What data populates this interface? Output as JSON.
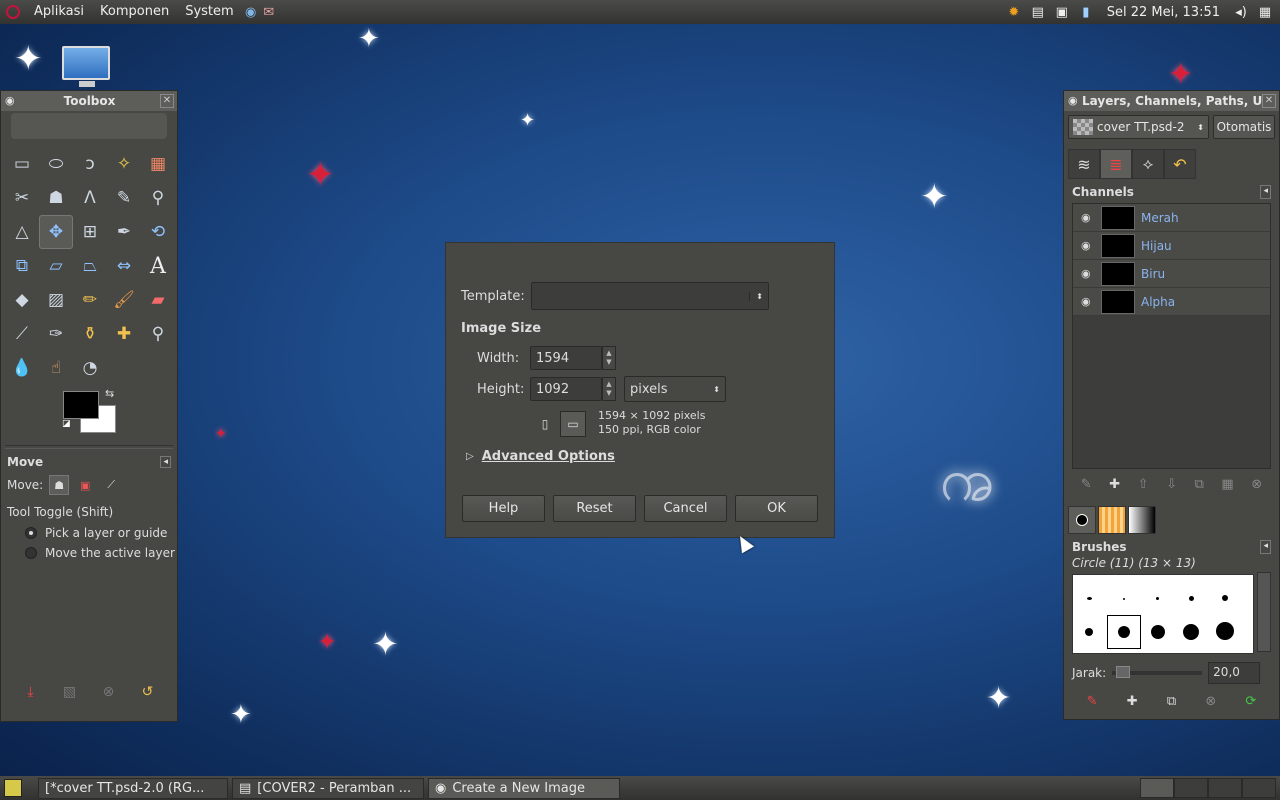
{
  "topbar": {
    "menus": [
      "Aplikasi",
      "Komponen",
      "System"
    ],
    "clock": "Sel 22 Mei, 13:51"
  },
  "toolbox": {
    "title": "Toolbox",
    "tool_options_title": "Move",
    "move_label": "Move:",
    "tool_toggle": "Tool Toggle  (Shift)",
    "radio_pick": "Pick a layer or guide",
    "radio_move": "Move the active layer"
  },
  "dock": {
    "title": "Layers, Channels, Paths, U",
    "image_combo": "cover TT.psd-2",
    "auto_button": "Otomatis",
    "channels_title": "Channels",
    "channels": [
      "Merah",
      "Hijau",
      "Biru",
      "Alpha"
    ],
    "brushes_title": "Brushes",
    "brush_name": "Circle (11) (13 × 13)",
    "spacing_label": "Jarak:",
    "spacing_value": "20,0"
  },
  "dialog": {
    "template_label": "Template:",
    "template_value": "",
    "image_size_title": "Image Size",
    "width_label": "Width:",
    "width_value": "1594",
    "height_label": "Height:",
    "height_value": "1092",
    "unit": "pixels",
    "info_line1": "1594 × 1092 pixels",
    "info_line2": "150 ppi, RGB color",
    "advanced_label": "Advanced Options",
    "help_label": "Help",
    "reset_label": "Reset",
    "cancel_label": "Cancel",
    "ok_label": "OK"
  },
  "taskbar": {
    "tasks": [
      "[*cover TT.psd-2.0 (RG...",
      "[COVER2 - Peramban ...",
      "Create a New Image"
    ]
  }
}
